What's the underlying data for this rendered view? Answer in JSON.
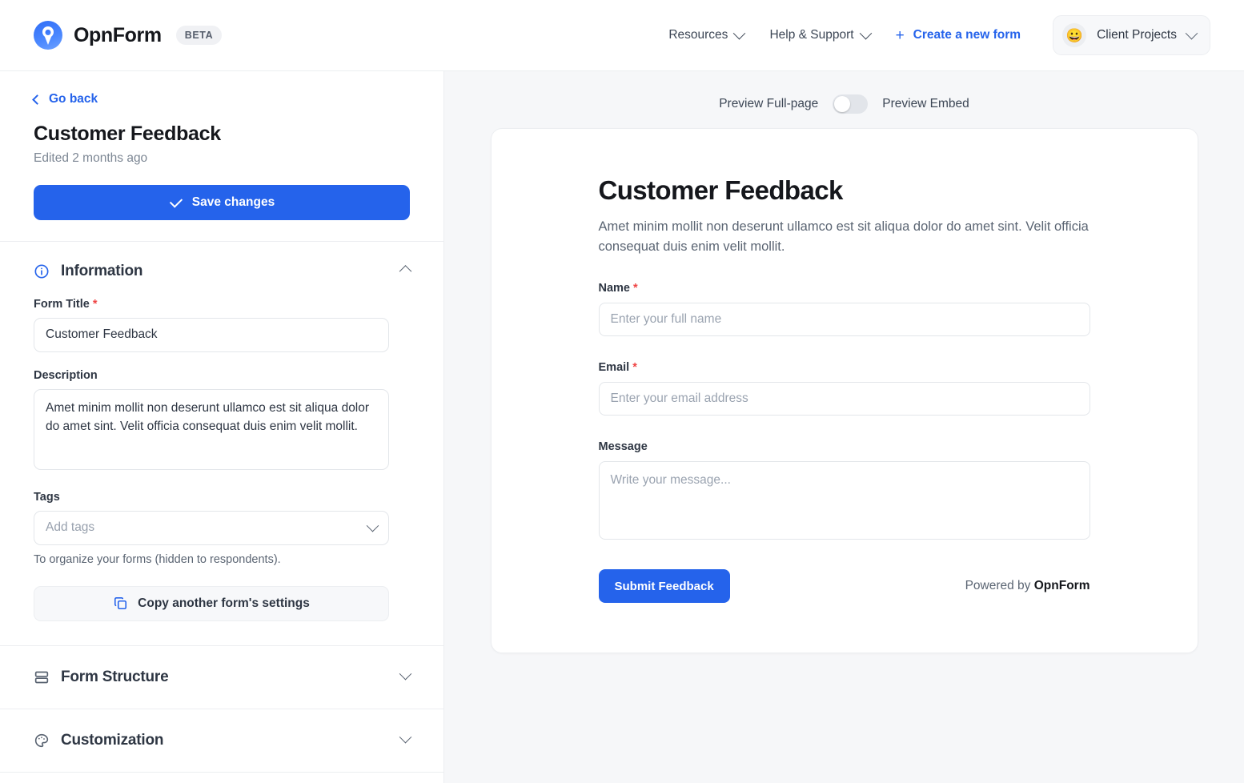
{
  "topbar": {
    "brand_name": "OpnForm",
    "beta_label": "BETA",
    "nav": [
      {
        "label": "Resources",
        "icon": "chevron-down-icon"
      },
      {
        "label": "Help & Support",
        "icon": "chevron-down-icon"
      }
    ],
    "create_label": "Create a new form",
    "create_plus": "+",
    "workspace": {
      "emoji": "😀",
      "label": "Client Projects"
    }
  },
  "sidebar": {
    "go_back": "Go back",
    "form_title": "Customer Feedback",
    "edited": "Edited 2 months ago",
    "save_label": "Save changes",
    "sections": [
      {
        "title": "Information",
        "icon": "info-circle-icon",
        "expanded": true
      },
      {
        "title": "Form Structure",
        "icon": "layout-rows-icon",
        "expanded": false
      },
      {
        "title": "Customization",
        "icon": "palette-icon",
        "expanded": false
      }
    ],
    "information": {
      "form_title_label": "Form Title",
      "form_title_required": "*",
      "form_title_value": "Customer Feedback",
      "description_label": "Description",
      "description_value": "Amet minim mollit non deserunt ullamco est sit aliqua dolor do amet sint. Velit officia consequat duis enim velit mollit.",
      "tags_label": "Tags",
      "tags_placeholder": "Add tags",
      "tags_helper": "To organize your forms (hidden to respondents).",
      "copy_settings_label": "Copy another form's settings"
    }
  },
  "main": {
    "preview_fullpage_label": "Preview Full-page",
    "preview_embed_label": "Preview Embed",
    "toggle_state": "off",
    "form": {
      "title": "Customer Feedback",
      "description": "Amet minim mollit non deserunt ullamco est sit aliqua dolor do amet sint. Velit officia consequat duis enim velit mollit.",
      "fields": [
        {
          "label": "Name",
          "required": "*",
          "placeholder": "Enter your full name",
          "type": "text"
        },
        {
          "label": "Email",
          "required": "*",
          "placeholder": "Enter your email address",
          "type": "text"
        },
        {
          "label": "Message",
          "required": "",
          "placeholder": "Write your message...",
          "type": "textarea"
        }
      ],
      "submit_label": "Submit Feedback",
      "powered_prefix": "Powered by ",
      "powered_brand": "OpnForm"
    }
  },
  "colors": {
    "accent": "#2563eb",
    "required": "#ef4444",
    "page_bg": "#f6f7f9",
    "border": "#eceef1"
  }
}
